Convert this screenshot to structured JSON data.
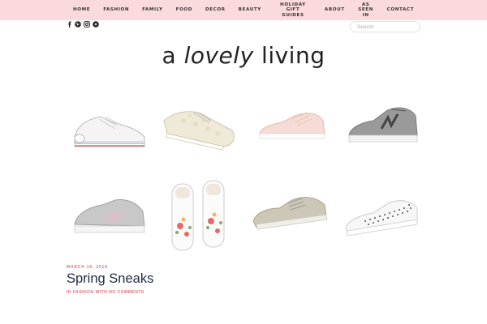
{
  "nav": {
    "items": [
      "HOME",
      "FASHION",
      "FAMILY",
      "FOOD",
      "DECOR",
      "BEAUTY",
      "HOLIDAY GIFT GUIDES",
      "ABOUT",
      "AS SEEN IN",
      "CONTACT"
    ]
  },
  "social": {
    "icons": [
      "facebook-icon",
      "pinterest-icon",
      "instagram-icon",
      "bloglovin-icon"
    ]
  },
  "search": {
    "placeholder": "Search"
  },
  "logo": {
    "prefix": "a",
    "script": "lovely",
    "suffix": "living"
  },
  "gallery": {
    "items": [
      {
        "name": "white-converse-sneaker"
      },
      {
        "name": "lace-keds-sneaker"
      },
      {
        "name": "pink-keds-sneaker"
      },
      {
        "name": "gray-new-balance-sneaker"
      },
      {
        "name": "gray-adidas-sneaker"
      },
      {
        "name": "floral-espadrille-slipon"
      },
      {
        "name": "taupe-lace-up-sneaker"
      },
      {
        "name": "polka-dot-white-sneaker"
      }
    ]
  },
  "post": {
    "date": "MARCH 16, 2018",
    "title": "Spring Sneaks",
    "meta_in": "IN",
    "category": "FASHION",
    "meta_with": "WITH",
    "comments": "NO COMMENTS"
  },
  "colors": {
    "nav_bg": "#fadadd",
    "accent": "#e0707a",
    "title": "#1e2a44"
  }
}
